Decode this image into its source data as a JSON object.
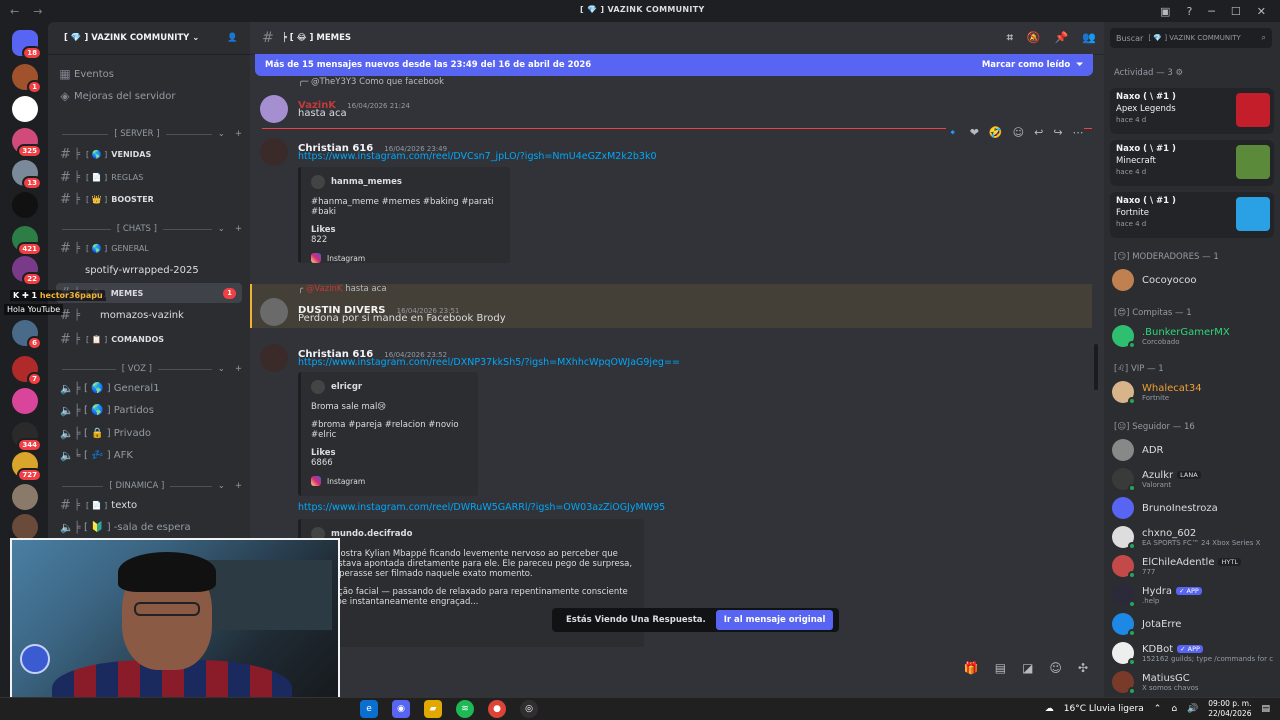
{
  "window": {
    "title": "VAZINK COMMUNITY",
    "title_prefix": "[ 💎 ]"
  },
  "rail": {
    "servers": [
      {
        "badge": "18",
        "color": "#5865f2"
      },
      {
        "badge": "1",
        "color": "#a0522d"
      },
      {
        "badge": "",
        "color": "#ffffff"
      },
      {
        "badge": "325",
        "color": "#d14b7a"
      },
      {
        "badge": "13",
        "color": "#7a8a9a"
      },
      {
        "badge": "",
        "color": "#111111"
      },
      {
        "badge": "421",
        "color": "#2d7d46"
      },
      {
        "badge": "22",
        "color": "#7a3a8a"
      },
      {
        "badge": "6",
        "color": "#4a6a8a"
      },
      {
        "badge": "7",
        "color": "#b02a2a"
      },
      {
        "badge": "",
        "color": "#d9459a"
      },
      {
        "badge": "344",
        "color": "#2a2a2a"
      },
      {
        "badge": "727",
        "color": "#d9a52a"
      },
      {
        "badge": "",
        "color": "#8a7a6a"
      },
      {
        "badge": "",
        "color": "#6a4a3a"
      }
    ]
  },
  "sidebar": {
    "guild_name": "VAZINK COMMUNITY",
    "guild_prefix": "[ 💎 ]",
    "events": "Eventos",
    "boosts": "Mejoras del servidor",
    "cat_server": "[ SERVER ]",
    "cat_chats": "[ CHATS ]",
    "cat_voz": "[ VOZ ]",
    "cat_dinamica": "[ DINAMICA ]",
    "channels": {
      "venidas": "VENIDAS",
      "reglas": "REGLAS",
      "booster": "BOOSTER",
      "general": "GENERAL",
      "spotify": "spotify-wrrapped-2025",
      "memes": "MEMES",
      "memes_badge": "1",
      "momazos": "momazos-vazink",
      "comandos": "COMANDOS",
      "general1": "General1",
      "partidos": "Partidos",
      "privado": "Privado",
      "afk": "AFK",
      "texto": "texto",
      "espera": "-sala de espera"
    }
  },
  "overlay": {
    "user": "hector36papu",
    "text": "Hola YouTube"
  },
  "chat": {
    "channel_name": "MEMES",
    "new_messages": "Más de 15 mensajes nuevos desde las 23:49 del 16 de abril de 2026",
    "mark_read": "Marcar como leído",
    "messages": [
      {
        "reply_to": "@TheY3Y3 Como que facebook",
        "author": "VazinK",
        "time": "16/04/2026 21:24",
        "text": "hasta aca"
      },
      {
        "author": "Christian 616",
        "time": "16/04/2026 23:49",
        "link": "https://www.instagram.com/reel/DVCsn7_jpLO/?igsh=NmU4eGZxM2k2b3k0",
        "embed": {
          "author": "hanma_memes",
          "desc": "#hanma_meme #memes #baking #parati #baki",
          "field": "Likes",
          "value": "822",
          "footer": "Instagram"
        }
      },
      {
        "reply_to": "hasta aca",
        "author": "DUSTIN DIVERS",
        "time": "16/04/2026 23:51",
        "text": "Perdona por si mande en Facebook Brody"
      },
      {
        "author": "Christian 616",
        "time": "16/04/2026 23:52",
        "link": "https://www.instagram.com/reel/DXNP37kkSh5/?igsh=MXhhcWpqOWJaG9jeg==",
        "embed": {
          "author": "elricgr",
          "desc": "Broma sale mal😢",
          "tags": "#broma #pareja #relacion #novio #elric",
          "field": "Likes",
          "value": "6866",
          "footer": "Instagram"
        },
        "link2": "https://www.instagram.com/reel/DWRuW5GARRl/?igsh=OW03azZiOGJyMW95",
        "embed2": {
          "author": "mundo.decifrado",
          "line1": "viral mostra Kylian Mbappé ficando levemente nervoso ao perceber que",
          "line2": "nera estava apontada diretamente para ele. Ele pareceu pego de surpresa,",
          "line3": "não esperasse ser filmado naquele exato momento.",
          "line4": "da reação facial — passando de relaxado para repentinamente consciente",
          "line5": "u o clipe instantaneamente engraçad..."
        }
      }
    ],
    "toast_text": "Estás Viendo Una Respuesta.",
    "toast_button": "Ir al mensaje original"
  },
  "members": {
    "search_placeholder": "Buscar",
    "search_scope": "[ 💎 ] VAZINK COMMUNITY",
    "activity_header": "Actividad — 3",
    "activity": [
      {
        "who": "Naxo ( \\ #1 )",
        "game": "Apex Legends",
        "ago": "hace 4 d"
      },
      {
        "who": "Naxo ( \\ #1 )",
        "game": "Minecraft",
        "ago": "hace 4 d"
      },
      {
        "who": "Naxo ( \\ #1 )",
        "game": "Fortnite",
        "ago": "hace 4 d"
      }
    ],
    "groups": [
      {
        "title": "[😏] MODERADORES — 1"
      },
      {
        "title": "[😍] Compitas — 1"
      },
      {
        "title": "[♌] VIP — 1"
      },
      {
        "title": "[😐] Seguidor — 16"
      }
    ],
    "list": [
      {
        "name": "Cocoyocoo",
        "sub": "",
        "tag": ""
      },
      {
        "name": ".BunkerGamerMX",
        "sub": "Corcobado",
        "tag": ""
      },
      {
        "name": "Whalecat34",
        "sub": "Fortnite",
        "tag": ""
      },
      {
        "name": "ADR",
        "sub": "",
        "tag": ""
      },
      {
        "name": "Azulkr",
        "sub": "Valorant",
        "tag": "LANA"
      },
      {
        "name": "BrunoInestroza",
        "sub": "",
        "tag": ""
      },
      {
        "name": "chxno_602",
        "sub": "EA SPORTS FC™ 24 Xbox Series X",
        "tag": ""
      },
      {
        "name": "ElChileAdentle",
        "sub": "777",
        "tag": "HYTL"
      },
      {
        "name": "Hydra",
        "sub": ".help",
        "tag": "✓ APP"
      },
      {
        "name": "JotaErre",
        "sub": "",
        "tag": ""
      },
      {
        "name": "KDBot",
        "sub": "152162 guilds; type /commands for c",
        "tag": "✓ APP"
      },
      {
        "name": "MatiusGC",
        "sub": "X somos chavos",
        "tag": ""
      }
    ]
  },
  "taskbar": {
    "weather": "16°C  Lluvia ligera",
    "time": "09:00 p. m.",
    "date": "22/04/2026"
  }
}
